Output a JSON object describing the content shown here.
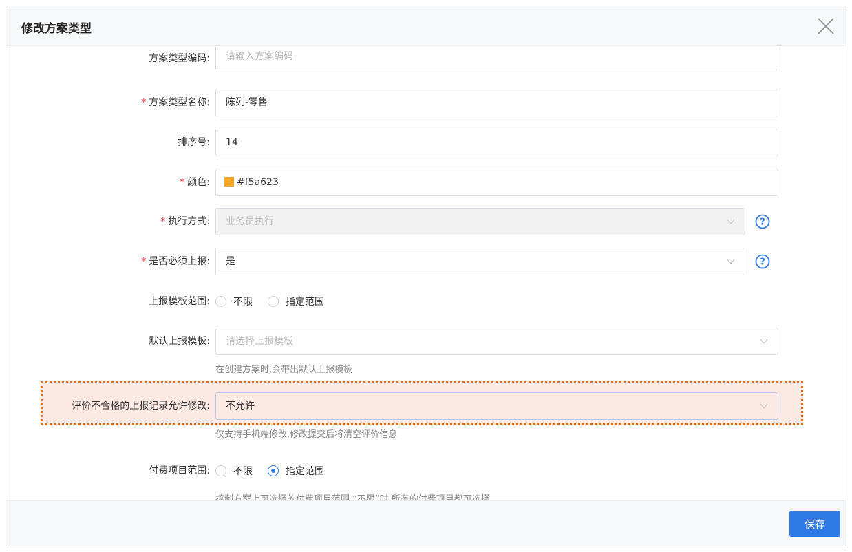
{
  "dialog": {
    "title": "修改方案类型",
    "save_label": "保存"
  },
  "form": {
    "code": {
      "label": "方案类型编码:",
      "placeholder": "请输入方案编码",
      "required": false
    },
    "name": {
      "label": "方案类型名称:",
      "value": "陈列-零售",
      "required": true
    },
    "sort": {
      "label": "排序号:",
      "value": "14",
      "required": false
    },
    "color": {
      "label": "颜色:",
      "value": "#f5a623",
      "swatch_color": "#f5a623",
      "required": true
    },
    "exec_mode": {
      "label": "执行方式:",
      "value": "业务员执行",
      "disabled": true,
      "required": true
    },
    "must_report": {
      "label": "是否必须上报:",
      "value": "是",
      "required": true
    },
    "template_scope": {
      "label": "上报模板范围:",
      "options": [
        "不限",
        "指定范围"
      ],
      "selected": null
    },
    "default_template": {
      "label": "默认上报模板:",
      "placeholder": "请选择上报模板",
      "hint": "在创建方案时,会带出默认上报模板"
    },
    "allow_modify": {
      "label": "评价不合格的上报记录允许修改:",
      "value": "不允许",
      "hint": "仅支持手机端修改,修改提交后将清空评价信息"
    },
    "fee_scope": {
      "label": "付费项目范围:",
      "options": [
        "不限",
        "指定范围"
      ],
      "selected": "指定范围",
      "hint": "控制方案上可选择的付费项目范围,“不限”时,所有的付费项目都可选择"
    }
  },
  "required_mark": "*",
  "colors": {
    "primary": "#2f7ae5",
    "required": "#f5222d",
    "highlight_bg": "#fde9e3",
    "highlight_border": "#e86a17"
  }
}
